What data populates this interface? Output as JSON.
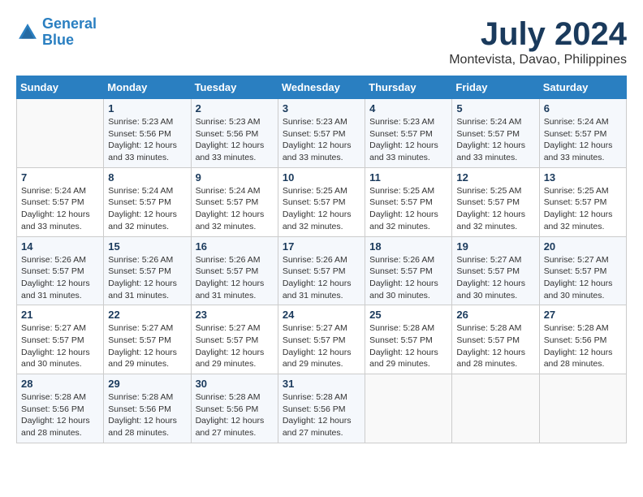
{
  "logo": {
    "line1": "General",
    "line2": "Blue"
  },
  "title": "July 2024",
  "subtitle": "Montevista, Davao, Philippines",
  "days_of_week": [
    "Sunday",
    "Monday",
    "Tuesday",
    "Wednesday",
    "Thursday",
    "Friday",
    "Saturday"
  ],
  "weeks": [
    [
      {
        "day": "",
        "info": ""
      },
      {
        "day": "1",
        "info": "Sunrise: 5:23 AM\nSunset: 5:56 PM\nDaylight: 12 hours\nand 33 minutes."
      },
      {
        "day": "2",
        "info": "Sunrise: 5:23 AM\nSunset: 5:56 PM\nDaylight: 12 hours\nand 33 minutes."
      },
      {
        "day": "3",
        "info": "Sunrise: 5:23 AM\nSunset: 5:57 PM\nDaylight: 12 hours\nand 33 minutes."
      },
      {
        "day": "4",
        "info": "Sunrise: 5:23 AM\nSunset: 5:57 PM\nDaylight: 12 hours\nand 33 minutes."
      },
      {
        "day": "5",
        "info": "Sunrise: 5:24 AM\nSunset: 5:57 PM\nDaylight: 12 hours\nand 33 minutes."
      },
      {
        "day": "6",
        "info": "Sunrise: 5:24 AM\nSunset: 5:57 PM\nDaylight: 12 hours\nand 33 minutes."
      }
    ],
    [
      {
        "day": "7",
        "info": "Sunrise: 5:24 AM\nSunset: 5:57 PM\nDaylight: 12 hours\nand 33 minutes."
      },
      {
        "day": "8",
        "info": "Sunrise: 5:24 AM\nSunset: 5:57 PM\nDaylight: 12 hours\nand 32 minutes."
      },
      {
        "day": "9",
        "info": "Sunrise: 5:24 AM\nSunset: 5:57 PM\nDaylight: 12 hours\nand 32 minutes."
      },
      {
        "day": "10",
        "info": "Sunrise: 5:25 AM\nSunset: 5:57 PM\nDaylight: 12 hours\nand 32 minutes."
      },
      {
        "day": "11",
        "info": "Sunrise: 5:25 AM\nSunset: 5:57 PM\nDaylight: 12 hours\nand 32 minutes."
      },
      {
        "day": "12",
        "info": "Sunrise: 5:25 AM\nSunset: 5:57 PM\nDaylight: 12 hours\nand 32 minutes."
      },
      {
        "day": "13",
        "info": "Sunrise: 5:25 AM\nSunset: 5:57 PM\nDaylight: 12 hours\nand 32 minutes."
      }
    ],
    [
      {
        "day": "14",
        "info": "Sunrise: 5:26 AM\nSunset: 5:57 PM\nDaylight: 12 hours\nand 31 minutes."
      },
      {
        "day": "15",
        "info": "Sunrise: 5:26 AM\nSunset: 5:57 PM\nDaylight: 12 hours\nand 31 minutes."
      },
      {
        "day": "16",
        "info": "Sunrise: 5:26 AM\nSunset: 5:57 PM\nDaylight: 12 hours\nand 31 minutes."
      },
      {
        "day": "17",
        "info": "Sunrise: 5:26 AM\nSunset: 5:57 PM\nDaylight: 12 hours\nand 31 minutes."
      },
      {
        "day": "18",
        "info": "Sunrise: 5:26 AM\nSunset: 5:57 PM\nDaylight: 12 hours\nand 30 minutes."
      },
      {
        "day": "19",
        "info": "Sunrise: 5:27 AM\nSunset: 5:57 PM\nDaylight: 12 hours\nand 30 minutes."
      },
      {
        "day": "20",
        "info": "Sunrise: 5:27 AM\nSunset: 5:57 PM\nDaylight: 12 hours\nand 30 minutes."
      }
    ],
    [
      {
        "day": "21",
        "info": "Sunrise: 5:27 AM\nSunset: 5:57 PM\nDaylight: 12 hours\nand 30 minutes."
      },
      {
        "day": "22",
        "info": "Sunrise: 5:27 AM\nSunset: 5:57 PM\nDaylight: 12 hours\nand 29 minutes."
      },
      {
        "day": "23",
        "info": "Sunrise: 5:27 AM\nSunset: 5:57 PM\nDaylight: 12 hours\nand 29 minutes."
      },
      {
        "day": "24",
        "info": "Sunrise: 5:27 AM\nSunset: 5:57 PM\nDaylight: 12 hours\nand 29 minutes."
      },
      {
        "day": "25",
        "info": "Sunrise: 5:28 AM\nSunset: 5:57 PM\nDaylight: 12 hours\nand 29 minutes."
      },
      {
        "day": "26",
        "info": "Sunrise: 5:28 AM\nSunset: 5:57 PM\nDaylight: 12 hours\nand 28 minutes."
      },
      {
        "day": "27",
        "info": "Sunrise: 5:28 AM\nSunset: 5:56 PM\nDaylight: 12 hours\nand 28 minutes."
      }
    ],
    [
      {
        "day": "28",
        "info": "Sunrise: 5:28 AM\nSunset: 5:56 PM\nDaylight: 12 hours\nand 28 minutes."
      },
      {
        "day": "29",
        "info": "Sunrise: 5:28 AM\nSunset: 5:56 PM\nDaylight: 12 hours\nand 28 minutes."
      },
      {
        "day": "30",
        "info": "Sunrise: 5:28 AM\nSunset: 5:56 PM\nDaylight: 12 hours\nand 27 minutes."
      },
      {
        "day": "31",
        "info": "Sunrise: 5:28 AM\nSunset: 5:56 PM\nDaylight: 12 hours\nand 27 minutes."
      },
      {
        "day": "",
        "info": ""
      },
      {
        "day": "",
        "info": ""
      },
      {
        "day": "",
        "info": ""
      }
    ]
  ]
}
